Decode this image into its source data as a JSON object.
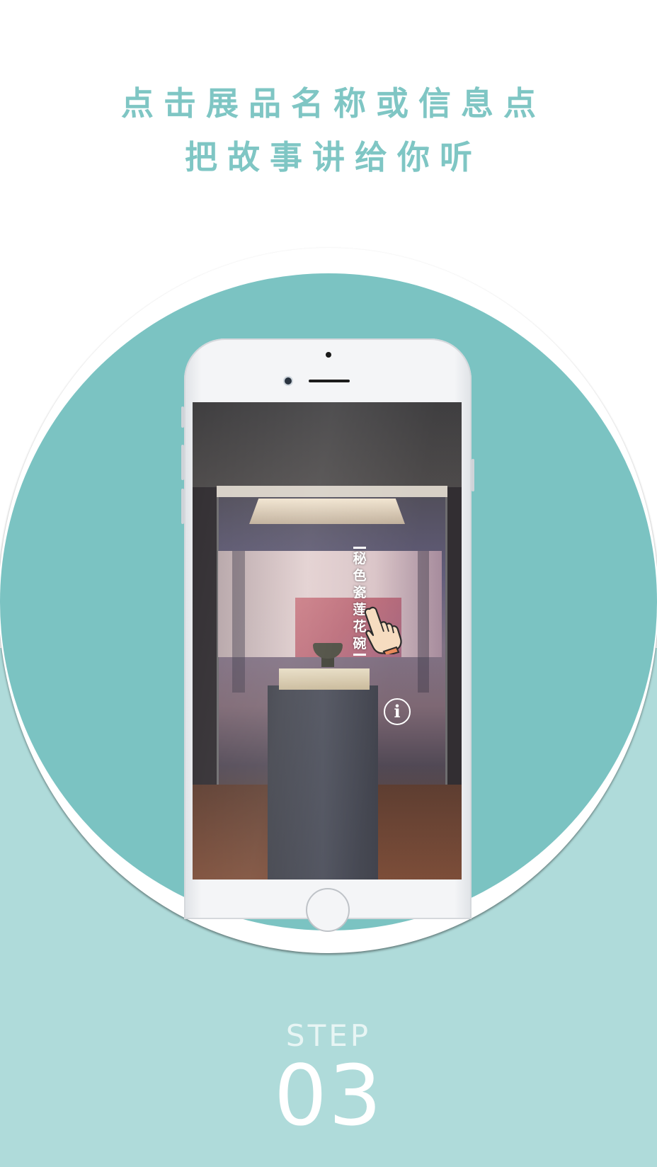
{
  "headline": {
    "line1": "点击展品名称或信息点",
    "line2": "把故事讲给你听"
  },
  "phone_screen": {
    "exhibit_label": "秘色瓷莲花碗",
    "info_icon_glyph": "i"
  },
  "step": {
    "label": "STEP",
    "number": "03"
  },
  "colors": {
    "accent_teal": "#7bc3c2",
    "light_teal": "#afdbda",
    "headline": "#7fc6c4"
  },
  "icons": [
    "info-icon",
    "pointing-hand-icon"
  ]
}
